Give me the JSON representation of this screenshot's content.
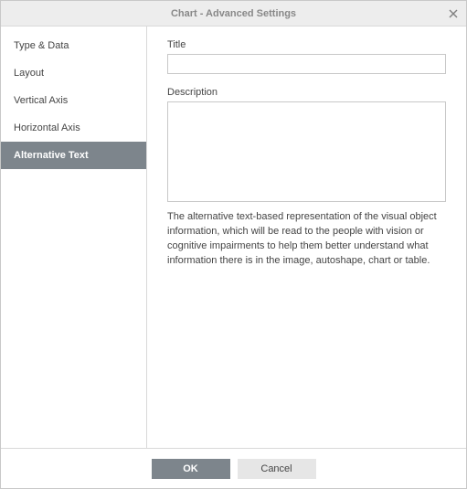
{
  "dialog": {
    "title": "Chart - Advanced Settings"
  },
  "sidebar": {
    "items": [
      {
        "label": "Type & Data",
        "active": false
      },
      {
        "label": "Layout",
        "active": false
      },
      {
        "label": "Vertical Axis",
        "active": false
      },
      {
        "label": "Horizontal Axis",
        "active": false
      },
      {
        "label": "Alternative Text",
        "active": true
      }
    ]
  },
  "content": {
    "title_label": "Title",
    "title_value": "",
    "description_label": "Description",
    "description_value": "",
    "help_text": "The alternative text-based representation of the visual object information, which will be read to the people with vision or cognitive impairments to help them better understand what information there is in the image, autoshape, chart or table."
  },
  "footer": {
    "ok_label": "OK",
    "cancel_label": "Cancel"
  }
}
